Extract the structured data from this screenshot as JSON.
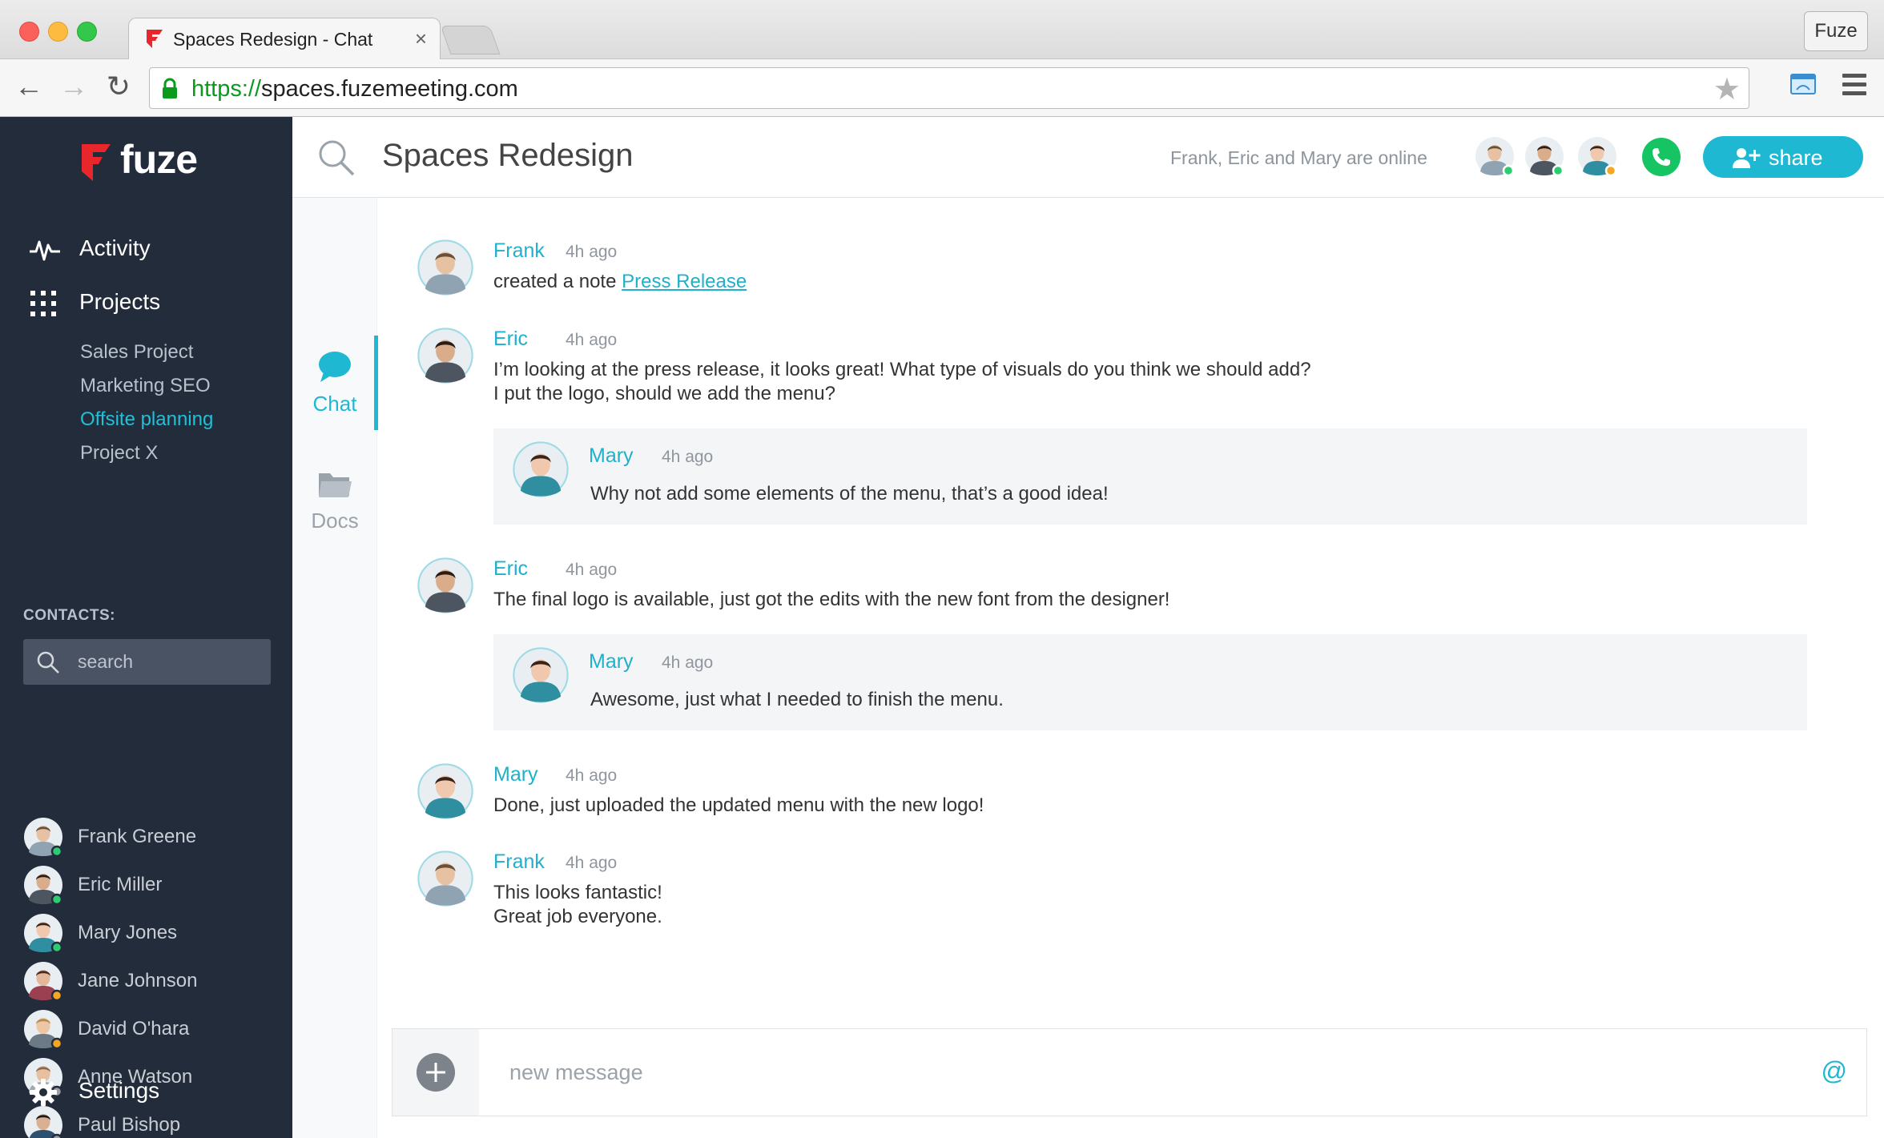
{
  "browser": {
    "tab_title": "Spaces Redesign - Chat",
    "tab_close": "×",
    "profile": "Fuze",
    "url_scheme": "https://",
    "url_rest": "spaces.fuzemeeting.com",
    "back": "←",
    "forward": "→",
    "reload": "↻",
    "star": "★"
  },
  "sidebar": {
    "brand": "fuze",
    "nav": {
      "activity": "Activity",
      "projects": "Projects"
    },
    "projects": [
      "Sales Project",
      "Marketing SEO",
      "Offsite planning",
      "Project X"
    ],
    "active_project": "Offsite planning",
    "contacts_label": "CONTACTS:",
    "search_placeholder": "search",
    "contacts": [
      {
        "name": "Frank Greene",
        "status": "online"
      },
      {
        "name": "Eric Miller",
        "status": "online"
      },
      {
        "name": "Mary Jones",
        "status": "online"
      },
      {
        "name": "Jane Johnson",
        "status": "away"
      },
      {
        "name": "David O'hara",
        "status": "away"
      },
      {
        "name": "Anne Watson",
        "status": "offline"
      },
      {
        "name": "Paul Bishop",
        "status": "offline"
      }
    ],
    "settings": "Settings"
  },
  "header": {
    "title": "Spaces Redesign",
    "online_text": "Frank, Eric and Mary are online",
    "share": "share"
  },
  "rail": {
    "chat": "Chat",
    "docs": "Docs"
  },
  "messages": [
    {
      "author": "Frank",
      "time": "4h ago",
      "text_prefix": "created a note ",
      "link": "Press Release"
    },
    {
      "author": "Eric",
      "time": "4h ago",
      "lines": [
        "I’m looking at the press release, it looks great! What type of visuals do you think we should add?",
        "I put the logo, should we add the menu?"
      ],
      "reply": {
        "author": "Mary",
        "time": "4h ago",
        "text": "Why not add some elements of the menu, that’s a good idea!"
      }
    },
    {
      "author": "Eric",
      "time": "4h ago",
      "lines": [
        "The final logo is available, just got the edits with the new font from the designer!"
      ],
      "reply": {
        "author": "Mary",
        "time": "4h ago",
        "text": "Awesome, just what I needed to finish the menu."
      }
    },
    {
      "author": "Mary",
      "time": "4h ago",
      "lines": [
        "Done, just uploaded the updated menu with the new logo!"
      ]
    },
    {
      "author": "Frank",
      "time": "4h ago",
      "lines": [
        "This looks fantastic!",
        "Great job everyone."
      ]
    }
  ],
  "composer": {
    "placeholder": "new message",
    "at": "@"
  },
  "colors": {
    "accent": "#1fb8d3",
    "sidebar_bg": "#232c3b",
    "online": "#2ecc71",
    "away": "#f5a623",
    "offline": "#9aa0a6",
    "call": "#17c464"
  }
}
